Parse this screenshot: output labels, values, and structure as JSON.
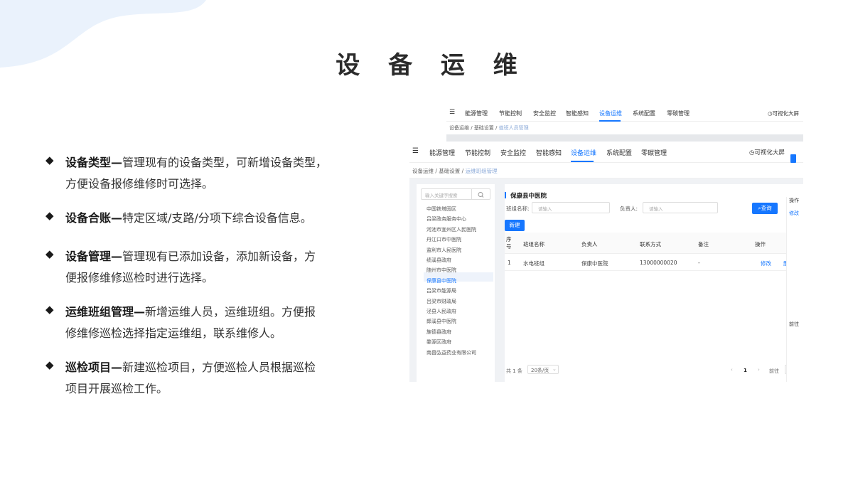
{
  "slide": {
    "title": "设 备 运 维",
    "colors": {
      "accent": "#1677ff",
      "blob": "#eaf2fc"
    },
    "bullets": [
      {
        "bold": "设备类型—",
        "lines": [
          "管理现有的设备类型，可新增设备类型，",
          "方便设备报修维修时可选择。"
        ]
      },
      {
        "bold": "设备合账—",
        "lines": [
          "特定区域/支路/分项下综合设备信息。"
        ]
      },
      {
        "bold": "设备管理—",
        "lines": [
          "管理现有已添加设备，添加新设备，方",
          "便报修维修巡检时进行选择。"
        ]
      },
      {
        "bold": "运维班组管理—",
        "lines": [
          "新增运维人员，运维班组。方便报",
          "修维修巡检选择指定运维组，联系维修人。"
        ]
      },
      {
        "bold": "巡检项目—",
        "lines": [
          "新建巡检项目，方便巡检人员根据巡检",
          "项目开展巡检工作。"
        ]
      }
    ]
  },
  "screenshot": {
    "nav_items": [
      "能源管理",
      "节能控制",
      "安全监控",
      "智能感知",
      "设备运维",
      "系统配置",
      "零碳管理"
    ],
    "active_nav": "设备运维",
    "big_screen": "可视化大屏",
    "back_breadcrumb": {
      "parts": [
        "设备运维",
        "基础设置"
      ],
      "current": "值班人员管理"
    },
    "front_breadcrumb": {
      "parts": [
        "设备运维",
        "基础设置"
      ],
      "current": "运维班组管理"
    },
    "tree_search_placeholder": "输入关键字搜索",
    "tree_items": [
      "中国铁塔园区",
      "吕梁政务服务中心",
      "河池市宜州区人民医院",
      "丹江口市中医院",
      "监利市人民医院",
      "绩溪县政府",
      "随州市中医院",
      "保康县中医院",
      "吕梁市能源局",
      "吕梁市财政局",
      "泾县人民政府",
      "郎溪县中医院",
      "旌德县政府",
      "婺源区政府",
      "南昌弘益药业有限公司"
    ],
    "selected_tree_item": "保康县中医院",
    "panel_title": "保康县中医院",
    "form": {
      "team_label": "班组名称:",
      "team_placeholder": "请输入",
      "leader_label": "负责人:",
      "leader_placeholder": "请输入",
      "query_button": "查询",
      "new_button": "新建"
    },
    "table": {
      "headers": [
        "序号",
        "班组名称",
        "负责人",
        "联系方式",
        "备注",
        "操作"
      ],
      "rows": [
        {
          "index": "1",
          "team": "水电班组",
          "leader": "保康中医院",
          "phone": "13000000020",
          "note": "-",
          "action": "修改",
          "action2": "删"
        }
      ]
    },
    "pagination": {
      "total": "共 1 条",
      "page_size": "20条/页",
      "current_page": "1",
      "goto_label": "前往"
    },
    "right_strip": {
      "header": "操作",
      "action": "修改",
      "goto": "前往"
    }
  }
}
